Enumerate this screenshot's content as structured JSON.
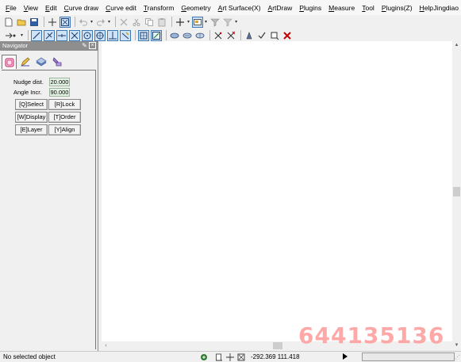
{
  "menu": {
    "items": [
      "File",
      "View",
      "Edit",
      "Curve draw",
      "Curve edit",
      "Transform",
      "Geometry",
      "Art Surface(X)",
      "ArtDraw",
      "Plugins",
      "Measure",
      "Tool",
      "Plugins(Z)",
      "Help"
    ],
    "user": "Jingdiao"
  },
  "toolbar1": {
    "icons": [
      "new-file-icon",
      "open-folder-icon",
      "save-icon",
      "crosshair-icon",
      "select-box-icon",
      "undo-icon",
      "redo-icon",
      "delete-icon",
      "cut-icon",
      "copy-icon",
      "paste-icon",
      "move-cross-icon",
      "view-box-icon",
      "funnel-icon",
      "funnel-clear-icon"
    ]
  },
  "toolbar2": {
    "icons": [
      "snap-menu-icon",
      "line-icon",
      "perpendicular-icon",
      "tangent-icon",
      "intersect-icon",
      "circle-center-icon",
      "circle-quadrant-icon",
      "perpendicular-foot-icon",
      "nearest-icon",
      "grid-point-icon",
      "grid-snap-icon",
      "surface-a-icon",
      "surface-b-icon",
      "surface-c-icon",
      "trim-icon",
      "trim-x-icon",
      "tool-a-icon",
      "check-icon",
      "layer-tool-icon",
      "red-x-icon"
    ]
  },
  "navigator": {
    "title": "Navigator",
    "tabs": [
      "object-tab-icon",
      "edit-tab-icon",
      "layer-tab-icon",
      "tool-tab-icon"
    ],
    "nudge_label": "Nudge dist.",
    "nudge_value": "20.000",
    "angle_label": "Angle Incr.",
    "angle_value": "90.000",
    "buttons": {
      "select": "[Q]Select",
      "lock": "[R]Lock",
      "display": "[W]Display",
      "order": "[T]Order",
      "layer": "[E]Layer",
      "align": "[Y]Align"
    }
  },
  "watermark": "644135136",
  "status": {
    "text": "No selected object",
    "coords": "-292.369 111.418"
  },
  "colors": {
    "navigator_title_bg": "#8e8e8e",
    "active_tool_border": "#3c78b5",
    "field_bg": "#e4f2e4",
    "watermark": "#ff9a9a"
  }
}
